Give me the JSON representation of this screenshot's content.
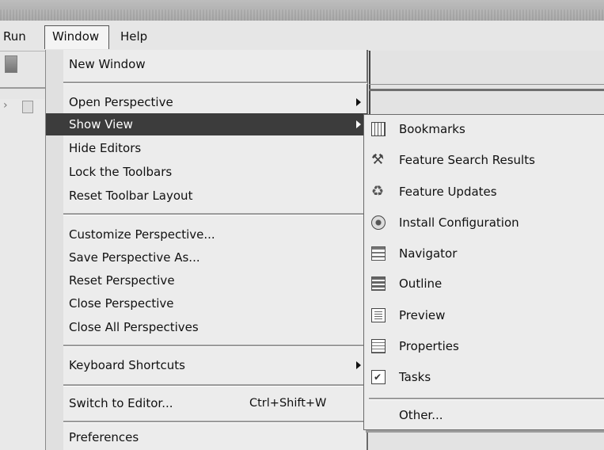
{
  "menubar": {
    "items": [
      "Run",
      "Window",
      "Help"
    ]
  },
  "window_menu": {
    "items": [
      {
        "label": "New Window"
      },
      {
        "label": "Open Perspective",
        "submenu": true
      },
      {
        "label": "Show View",
        "submenu": true,
        "selected": true
      },
      {
        "label": "Hide Editors"
      },
      {
        "label": "Lock the Toolbars"
      },
      {
        "label": "Reset Toolbar Layout"
      },
      {
        "label": "Customize Perspective..."
      },
      {
        "label": "Save Perspective As..."
      },
      {
        "label": "Reset Perspective"
      },
      {
        "label": "Close Perspective"
      },
      {
        "label": "Close All Perspectives"
      },
      {
        "label": "Keyboard Shortcuts",
        "submenu": true
      },
      {
        "label": "Switch to Editor...",
        "accelerator": "Ctrl+Shift+W"
      },
      {
        "label": "Preferences"
      }
    ]
  },
  "show_view_submenu": {
    "items": [
      {
        "label": "Bookmarks",
        "icon": "bookmarks-icon"
      },
      {
        "label": "Feature Search Results",
        "icon": "feature-search-icon"
      },
      {
        "label": "Feature Updates",
        "icon": "feature-updates-icon"
      },
      {
        "label": "Install Configuration",
        "icon": "install-configuration-icon"
      },
      {
        "label": "Navigator",
        "icon": "navigator-icon"
      },
      {
        "label": "Outline",
        "icon": "outline-icon"
      },
      {
        "label": "Preview",
        "icon": "preview-icon"
      },
      {
        "label": "Properties",
        "icon": "properties-icon"
      },
      {
        "label": "Tasks",
        "icon": "tasks-icon"
      },
      {
        "label": "Other..."
      }
    ]
  },
  "colors": {
    "selection": "#3c3c3c",
    "menu_background": "#ececec"
  }
}
